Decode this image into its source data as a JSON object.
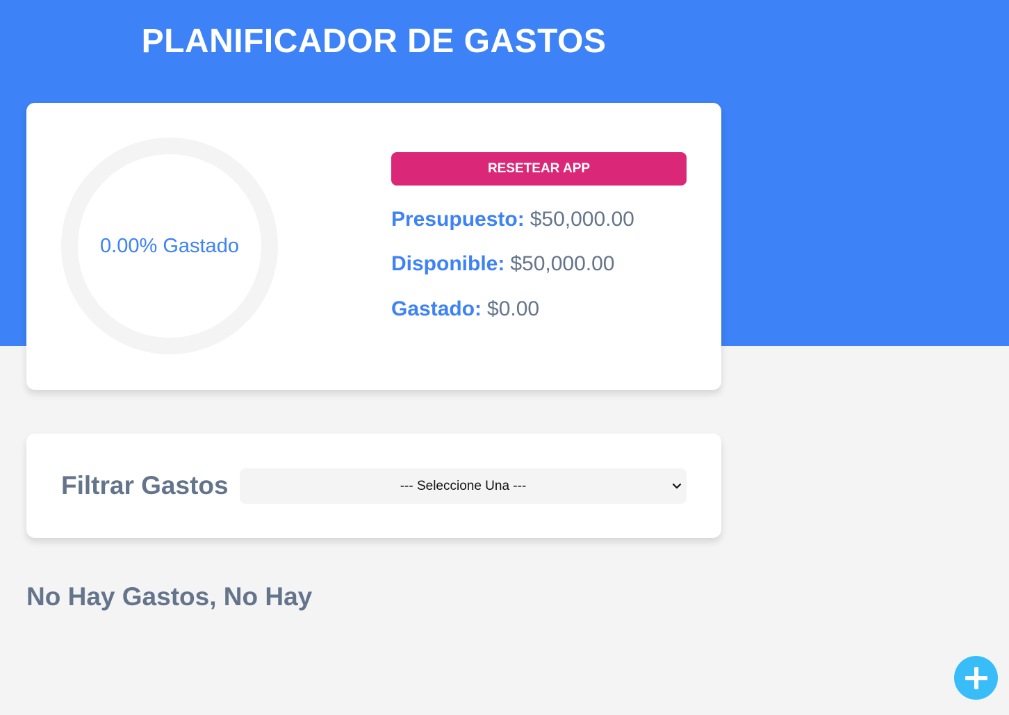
{
  "header": {
    "title": "PLANIFICADOR DE GASTOS"
  },
  "budget": {
    "progress_label": "0.00% Gastado",
    "progress_fraction": 0,
    "reset_label": "RESETEAR APP",
    "stats": {
      "budget_label": "Presupuesto:",
      "budget_value": "$50,000.00",
      "available_label": "Disponible:",
      "available_value": "$50,000.00",
      "spent_label": "Gastado:",
      "spent_value": "$0.00"
    }
  },
  "filter": {
    "label": "Filtrar Gastos",
    "selected": "--- Seleccione Una ---",
    "icon": "chevron-down-icon"
  },
  "expenses": {
    "empty_message": "No Hay Gastos, No Hay"
  },
  "add_button": {
    "icon": "plus-icon"
  },
  "colors": {
    "primary": "#3d82f6",
    "accent": "#db2777",
    "fab": "#38bdf8",
    "text_muted": "#64748b",
    "background": "#f4f4f4"
  }
}
